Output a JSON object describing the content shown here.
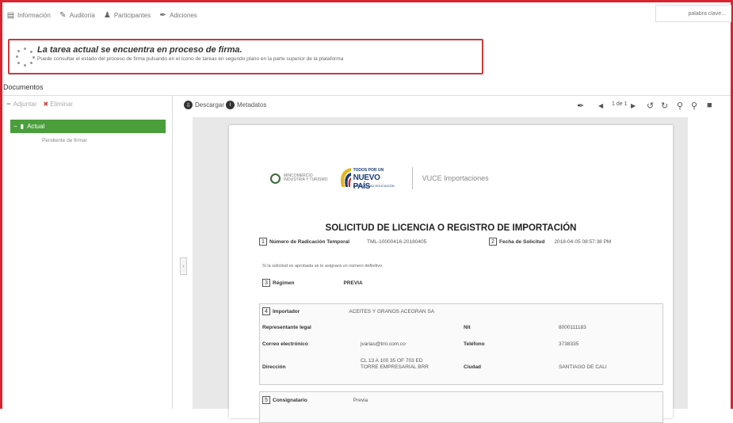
{
  "tabs": [
    {
      "label": "Información",
      "icon": "info-icon"
    },
    {
      "label": "Auditoría",
      "icon": "audit-icon"
    },
    {
      "label": "Participantes",
      "icon": "participants-icon"
    },
    {
      "label": "Adiciones",
      "icon": "attachment-icon"
    }
  ],
  "search": {
    "placeholder": "palabra clave..."
  },
  "alert": {
    "title": "La tarea actual se encuentra en proceso de firma.",
    "description": "Puede consultar el estado del proceso de firma pulsando en el ícono de tareas en segundo plano en la parte superior de la plataforma"
  },
  "documents": {
    "header": "Documentos",
    "toolbar": {
      "attach": "Adjuntar",
      "delete": "Eliminar"
    },
    "tree": {
      "item": "Actual",
      "subitem": "Pendiente de firmar"
    }
  },
  "viewer": {
    "download": "Descargar",
    "metadata": "Metadatos",
    "page_indicator": "1 de 1"
  },
  "doc": {
    "logo_mincit": "MINCOMERCIO\nINDUSTRIA Y TURISMO",
    "logo_pais_top": "TODOS POR UN",
    "logo_pais_main": "NUEVO PAÍS",
    "logo_pais_bottom": "PAZ EQUIDAD EDUCACIÓN",
    "logo_vuce": "VUCE Importaciones",
    "title": "SOLICITUD DE LICENCIA O REGISTRO DE IMPORTACIÓN",
    "f1": {
      "num": "1",
      "label": "Número de Radicación Temporal",
      "value": "TML-10000416-20180405"
    },
    "f2": {
      "num": "2",
      "label": "Fecha de Solicitud",
      "value": "2018-04-05 08:57:38 PM"
    },
    "note": "Si la solicitud es aprobada se le asignará un número definitivo",
    "f3": {
      "num": "3",
      "label": "Régimen",
      "value": "PREVIA"
    },
    "f4": {
      "num": "4",
      "label": "Importador",
      "value": "ACEITES Y GRANOS ACEGRAN SA"
    },
    "rep": {
      "label": "Representante legal",
      "nit_label": "Nit",
      "nit_value": "8000111183"
    },
    "email": {
      "label": "Correo electrónico",
      "value": "jvarias@tmi.com.co",
      "tel_label": "Teléfono",
      "tel_value": "3738335"
    },
    "address": {
      "label": "Dirección",
      "value_line1": "CL 13 A 100 35 OF 703 ED",
      "value_line2": "TORRE EMPRESARIAL BRR",
      "city_label": "Ciudad",
      "city_value": "SANTIAGO DE CALI"
    },
    "f5": {
      "num": "5",
      "label": "Consignatario",
      "value": "Previa"
    }
  },
  "colors": {
    "accent_green": "#4a9e3c",
    "frame_red": "#d9232e",
    "alert_border": "#c9393f"
  }
}
